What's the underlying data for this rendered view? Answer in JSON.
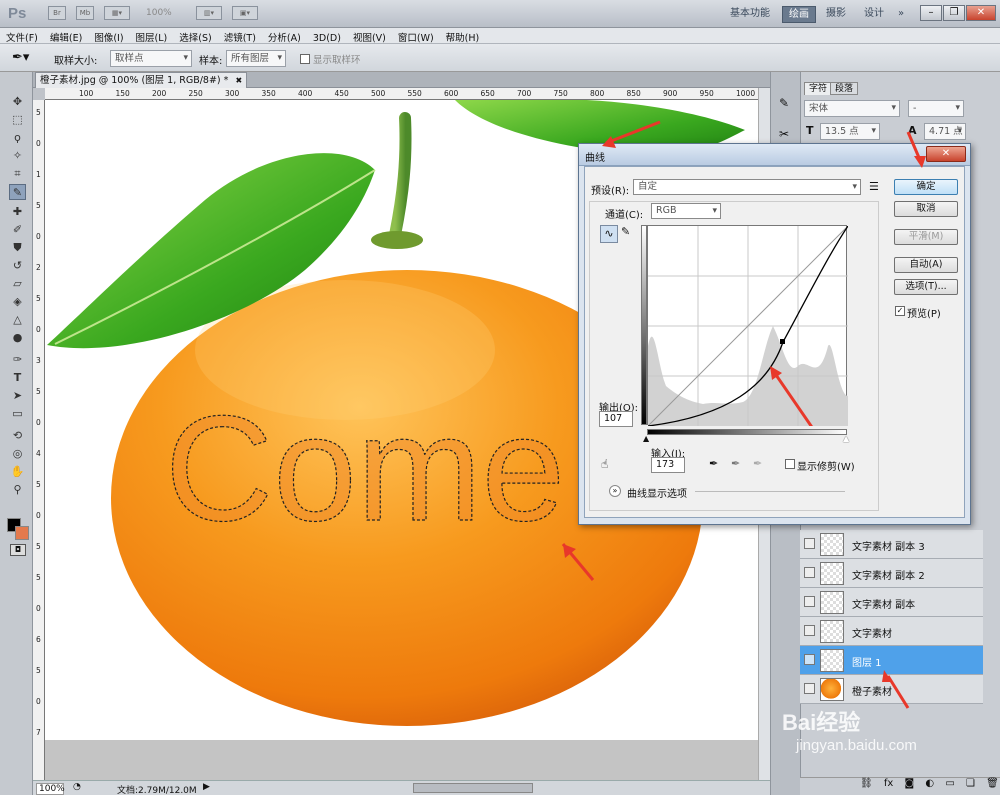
{
  "app": {
    "logo": "Ps",
    "mini_icons": [
      "Br",
      "Mb"
    ],
    "zoom_display": "100%",
    "workspaces": [
      "基本功能",
      "绘画",
      "摄影",
      "设计",
      "»"
    ],
    "active_workspace": "绘画"
  },
  "menu": [
    "文件(F)",
    "编辑(E)",
    "图像(I)",
    "图层(L)",
    "选择(S)",
    "滤镜(T)",
    "分析(A)",
    "3D(D)",
    "视图(V)",
    "窗口(W)",
    "帮助(H)"
  ],
  "options_bar": {
    "sample_size_label": "取样大小:",
    "sample_size_value": "取样点",
    "sample_label": "样本:",
    "sample_value": "所有图层",
    "show_ring_label": "显示取样环"
  },
  "document": {
    "tab_title": "橙子素材.jpg @ 100% (图层 1, RGB/8#) *",
    "ruler_h": [
      "100",
      "150",
      "200",
      "250",
      "300",
      "350",
      "400",
      "450",
      "500",
      "550",
      "600",
      "650",
      "700",
      "750",
      "800",
      "850",
      "900",
      "950",
      "1000"
    ],
    "ruler_v": [
      "5",
      "0",
      "1",
      "5",
      "0",
      "2",
      "5",
      "0",
      "3",
      "5",
      "0",
      "4",
      "5",
      "0",
      "5",
      "5",
      "0",
      "6",
      "5",
      "0",
      "7"
    ],
    "overlay_text": "Come"
  },
  "status": {
    "zoom": "100%",
    "doc_info": "文档:2.79M/12.0M"
  },
  "char_panel": {
    "tabs": [
      "字符",
      "段落"
    ],
    "font": "宋体",
    "style": "-",
    "size": "13.5 点",
    "leading": "4.71 点"
  },
  "layers": [
    {
      "name": "文字素材 副本 3",
      "visible": false,
      "active": false
    },
    {
      "name": "文字素材 副本 2",
      "visible": false,
      "active": false
    },
    {
      "name": "文字素材 副本",
      "visible": false,
      "active": false
    },
    {
      "name": "文字素材",
      "visible": false,
      "active": false
    },
    {
      "name": "图层 1",
      "visible": true,
      "active": true
    },
    {
      "name": "橙子素材",
      "visible": true,
      "active": false
    }
  ],
  "curves_dialog": {
    "title": "曲线",
    "preset_label": "预设(R):",
    "preset_value": "自定",
    "channel_label": "通道(C):",
    "channel_value": "RGB",
    "output_label": "输出(O):",
    "output_value": "107",
    "input_label": "输入(I):",
    "input_value": "173",
    "show_clipping_label": "显示修剪(W)",
    "curve_options_label": "曲线显示选项",
    "buttons": {
      "ok": "确定",
      "cancel": "取消",
      "smooth": "平滑(M)",
      "auto": "自动(A)",
      "options": "选项(T)..."
    },
    "preview_label": "预览(P)",
    "preview_checked": true
  },
  "watermark": {
    "brand": "Bai经验",
    "url": "jingyan.baidu.com"
  },
  "colors": {
    "accent": "#4fa1ea",
    "annotation_arrow": "#e8382a"
  }
}
